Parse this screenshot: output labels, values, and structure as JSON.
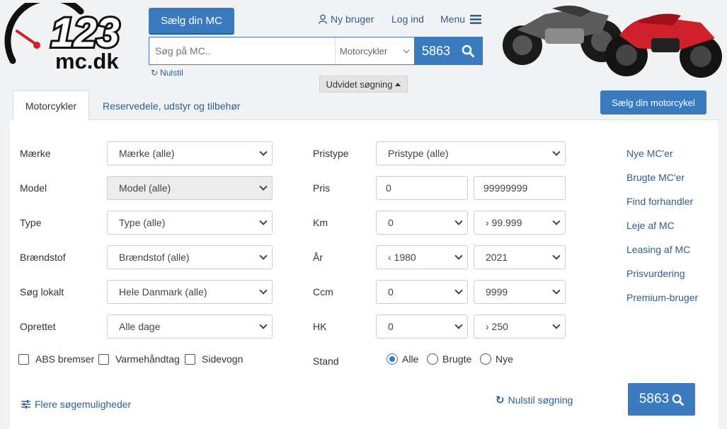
{
  "header": {
    "logo_number": "123",
    "logo_domain": "mc.dk",
    "sell_button": "Sælg din MC",
    "new_user": "Ny bruger",
    "login": "Log ind",
    "menu": "Menu",
    "search_placeholder": "Søg på MC..",
    "category": "Motorcykler",
    "result_count": "5863",
    "reset": "Nulstil",
    "advanced": "Udvidet søgning"
  },
  "tabs": {
    "active": "Motorcykler",
    "other": "Reservedele, udstyr og tilbehør",
    "sell_button": "Sælg din motorcykel"
  },
  "filters": {
    "brand": {
      "label": "Mærke",
      "value": "Mærke (alle)"
    },
    "model": {
      "label": "Model",
      "value": "Model (alle)"
    },
    "type": {
      "label": "Type",
      "value": "Type (alle)"
    },
    "fuel": {
      "label": "Brændstof",
      "value": "Brændstof (alle)"
    },
    "local": {
      "label": "Søg lokalt",
      "value": "Hele Danmark (alle)"
    },
    "created": {
      "label": "Oprettet",
      "value": "Alle dage"
    },
    "price_type": {
      "label": "Pristype",
      "value": "Pristype (alle)"
    },
    "price": {
      "label": "Pris",
      "min": "0",
      "max": "99999999"
    },
    "km": {
      "label": "Km",
      "min": "0",
      "max": "› 99.999"
    },
    "year": {
      "label": "År",
      "min": "‹ 1980",
      "max": "2021"
    },
    "ccm": {
      "label": "Ccm",
      "min": "0",
      "max": "9999"
    },
    "hk": {
      "label": "HK",
      "min": "0",
      "max": "› 250"
    },
    "checkboxes": [
      "ABS bremser",
      "Varmehåndtag",
      "Sidevogn"
    ],
    "condition": {
      "label": "Stand",
      "options": [
        "Alle",
        "Brugte",
        "Nye"
      ],
      "selected": "Alle"
    }
  },
  "sidebar": {
    "links": [
      "Nye MC'er",
      "Brugte MC'er",
      "Find forhandler",
      "Leje af MC",
      "Leasing af MC",
      "Prisvurdering",
      "Premium-bruger"
    ]
  },
  "footer": {
    "more_options": "Flere søgemuligheder",
    "reset_search": "Nulstil søgning",
    "count": "5863"
  },
  "colors": {
    "accent": "#3a7bbf",
    "link": "#2d5f8e",
    "logo_red": "#d0202a"
  }
}
